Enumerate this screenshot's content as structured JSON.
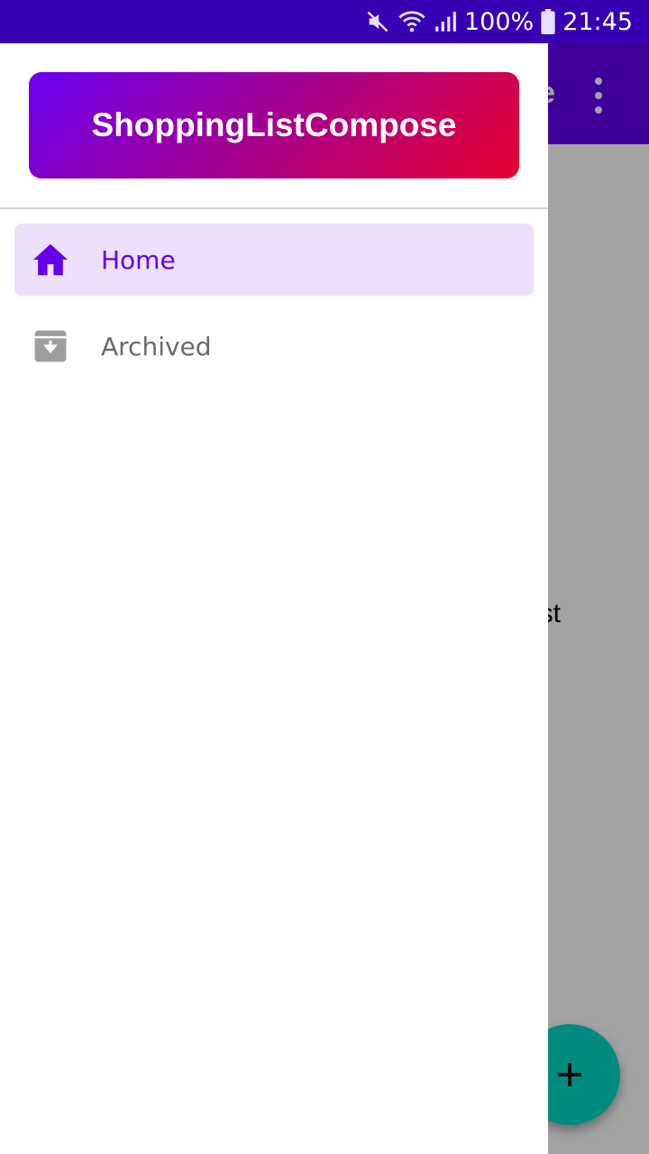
{
  "status_bar": {
    "battery": "100%",
    "time": "21:45",
    "icons": [
      "mute-icon",
      "wifi-icon",
      "signal-icon",
      "battery-icon"
    ]
  },
  "app_bar": {
    "title_fragment": "e",
    "overflow_icon": "more-vert-icon"
  },
  "main": {
    "empty_text_fragment": "st",
    "fab_icon": "plus-icon"
  },
  "drawer": {
    "title": "ShoppingListCompose",
    "items": [
      {
        "label": "Home",
        "icon": "home-icon",
        "selected": true
      },
      {
        "label": "Archived",
        "icon": "archive-icon",
        "selected": false
      }
    ]
  },
  "colors": {
    "status_bar": "#3700b3",
    "primary": "#6200ee",
    "selected_bg": "#ede0fb",
    "fab": "#03dac5",
    "gradient_start": "#6a00f4",
    "gradient_end": "#e8002f"
  }
}
